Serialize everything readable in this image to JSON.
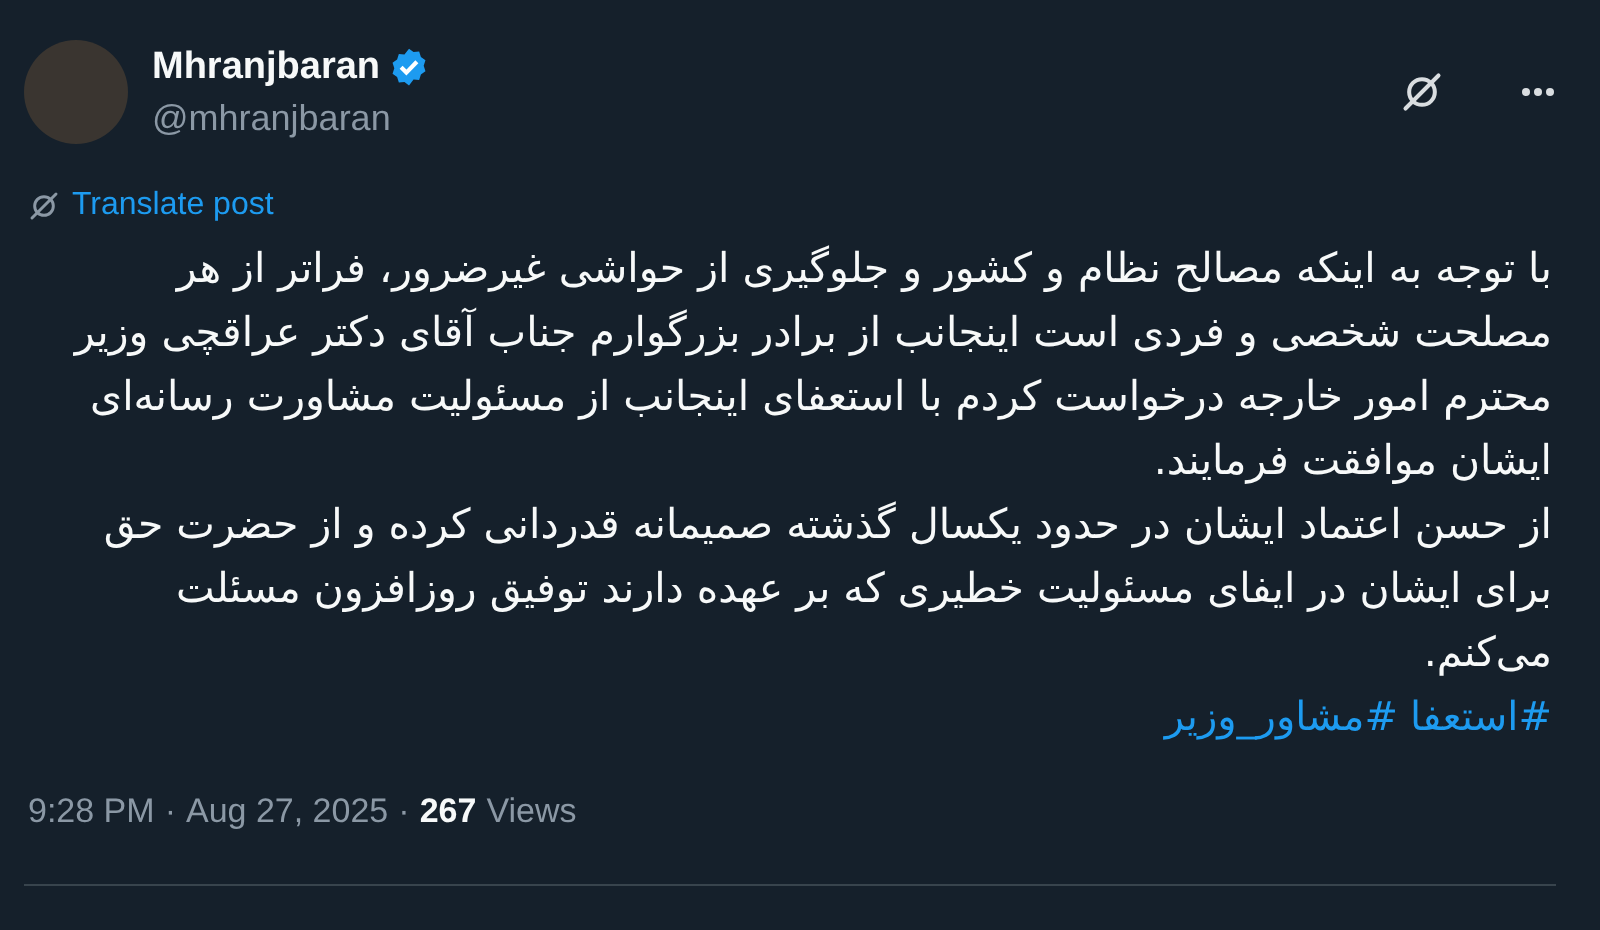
{
  "author": {
    "name": "Mhranjbaran",
    "verified": true,
    "handle": "@mhranjbaran"
  },
  "translate": {
    "label": "Translate post"
  },
  "body": [
    "با توجه به اینکه مصالح نظام و کشور و جلوگیری از حواشی غیرضرور، فراتر از هر مصلحت شخصی و فردی است اینجانب از برادر بزرگوارم جناب آقای دکتر عراقچی وزیر محترم امور خارجه درخواست کردم با استعفای اینجانب از مسئولیت مشاورت رسانه‌ای ایشان موافقت فرمایند.",
    "از حسن اعتماد ایشان در حدود یکسال گذشته صمیمانه قدردانی کرده و از حضرت حق برای ایشان در ایفای مسئولیت خطیری که بر عهده دارند توفیق روزافزون مسئلت می‌کنم."
  ],
  "hashtags": [
    "#استعفا",
    "#مشاور_وزیر"
  ],
  "meta": {
    "time": "9:28 PM",
    "separator_1": "·",
    "date": "Aug 27, 2025",
    "separator_2": "·",
    "views_count": "267",
    "views_label": "Views"
  }
}
